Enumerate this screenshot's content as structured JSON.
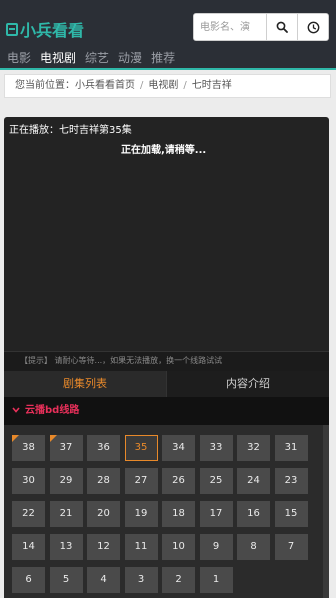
{
  "header": {
    "logo_text": "小兵看看",
    "search_placeholder": "电影名、演",
    "nav": [
      "电影",
      "电视剧",
      "综艺",
      "动漫",
      "推荐"
    ],
    "nav_active_index": 1
  },
  "breadcrumb": {
    "prefix": "您当前位置：",
    "items": [
      "小兵看看首页",
      "电视剧",
      "七时吉祥"
    ],
    "separator": "/"
  },
  "player": {
    "now_playing": "正在播放：七时吉祥第35集",
    "loading": "正在加载,请稍等...",
    "tip": "【提示】 请耐心等待...，如果无法播放，换一个线路试试"
  },
  "tabs": [
    {
      "label": "剧集列表",
      "active": true
    },
    {
      "label": "内容介绍",
      "active": false
    }
  ],
  "episodes": {
    "source_label": "云播bd线路",
    "current": "35",
    "new_marked": [
      "38",
      "37"
    ],
    "list": [
      "38",
      "37",
      "36",
      "35",
      "34",
      "33",
      "32",
      "31",
      "30",
      "29",
      "28",
      "27",
      "26",
      "25",
      "24",
      "23",
      "22",
      "21",
      "20",
      "19",
      "18",
      "17",
      "16",
      "15",
      "14",
      "13",
      "12",
      "11",
      "10",
      "9",
      "8",
      "7",
      "6",
      "5",
      "4",
      "3",
      "2",
      "1"
    ]
  },
  "colors": {
    "accent": "#2fb8a9",
    "header_bg": "#2b2f36",
    "current_episode": "#e8892a",
    "source_line": "#e8305a"
  }
}
